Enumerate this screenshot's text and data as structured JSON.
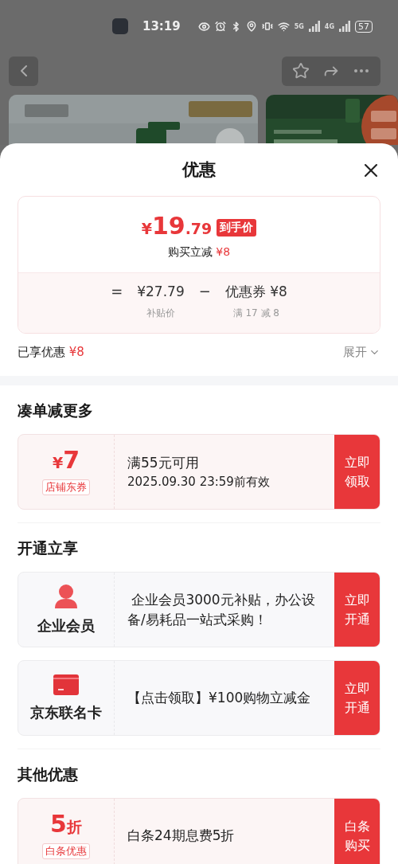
{
  "status_bar": {
    "time": "13:19",
    "networks": [
      "5G",
      "4G"
    ],
    "battery": "57"
  },
  "sheet": {
    "title": "优惠",
    "price_card": {
      "currency": "¥",
      "integer": "19",
      "decimal": ".79",
      "tag": "到手价",
      "reduction_label": "购买立减",
      "reduction_amount": "¥8",
      "breakdown": [
        {
          "kind": "operator",
          "text": "="
        },
        {
          "kind": "operand",
          "value": "¥27.79",
          "caption": "补贴价"
        },
        {
          "kind": "operator",
          "text": "−"
        },
        {
          "kind": "operand",
          "value": "优惠券 ¥8",
          "caption": "满 17 减 8"
        }
      ]
    },
    "savings": {
      "label": "已享优惠",
      "amount": "¥8",
      "expand": "展开"
    },
    "sections": [
      {
        "heading": "凑单减更多",
        "offers": [
          {
            "kind": "coupon",
            "currency": "¥",
            "amount": "7",
            "tag": "店铺东券",
            "lines": [
              "满55元可用",
              "2025.09.30 23:59前有效"
            ],
            "action": "立即领取"
          }
        ]
      },
      {
        "heading": "开通立享",
        "offers": [
          {
            "kind": "membership",
            "name": "企业会员",
            "lines": [
              " 企业会员3000元补贴，办公设备/易耗品一站式采购！"
            ],
            "action": "立即开通"
          },
          {
            "kind": "cobrand_card",
            "name": "京东联名卡",
            "lines": [
              "【点击领取】¥100购物立减金"
            ],
            "action": "立即开通"
          }
        ]
      },
      {
        "heading": "其他优惠",
        "offers": [
          {
            "kind": "discount",
            "amount": "5",
            "unit": "折",
            "tag": "白条优惠",
            "lines": [
              "白条24期息费5折"
            ],
            "action": "白条购买"
          }
        ]
      }
    ]
  }
}
